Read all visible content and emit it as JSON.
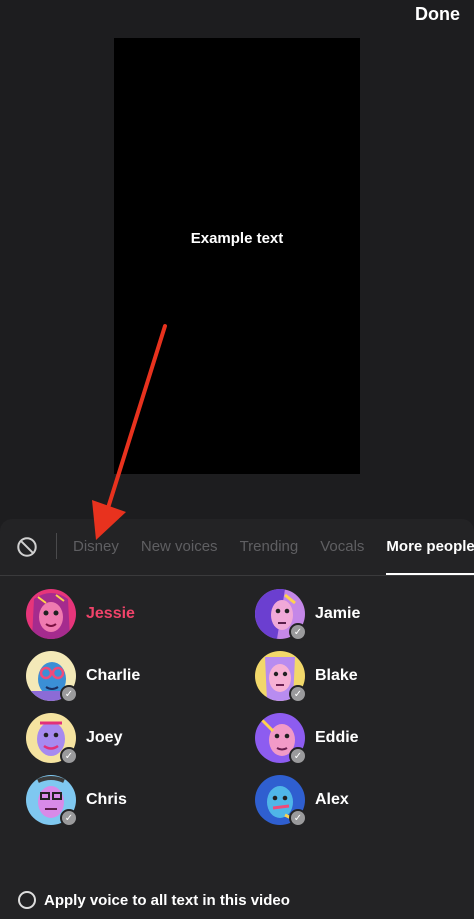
{
  "header": {
    "done_label": "Done"
  },
  "preview": {
    "text": "Example text"
  },
  "tabs": [
    {
      "label": "Disney"
    },
    {
      "label": "New voices"
    },
    {
      "label": "Trending"
    },
    {
      "label": "Vocals"
    },
    {
      "label": "More people"
    }
  ],
  "voices": [
    {
      "name": "Jessie",
      "selected": true
    },
    {
      "name": "Jamie"
    },
    {
      "name": "Charlie"
    },
    {
      "name": "Blake"
    },
    {
      "name": "Joey"
    },
    {
      "name": "Eddie"
    },
    {
      "name": "Chris"
    },
    {
      "name": "Alex"
    }
  ],
  "apply": {
    "label": "Apply voice to all text in this video"
  },
  "colors": {
    "accent": "#f0436a",
    "annotation_arrow": "#e8321e"
  },
  "icons": {
    "no_voice": "ban-icon",
    "downloaded": "check-icon"
  }
}
